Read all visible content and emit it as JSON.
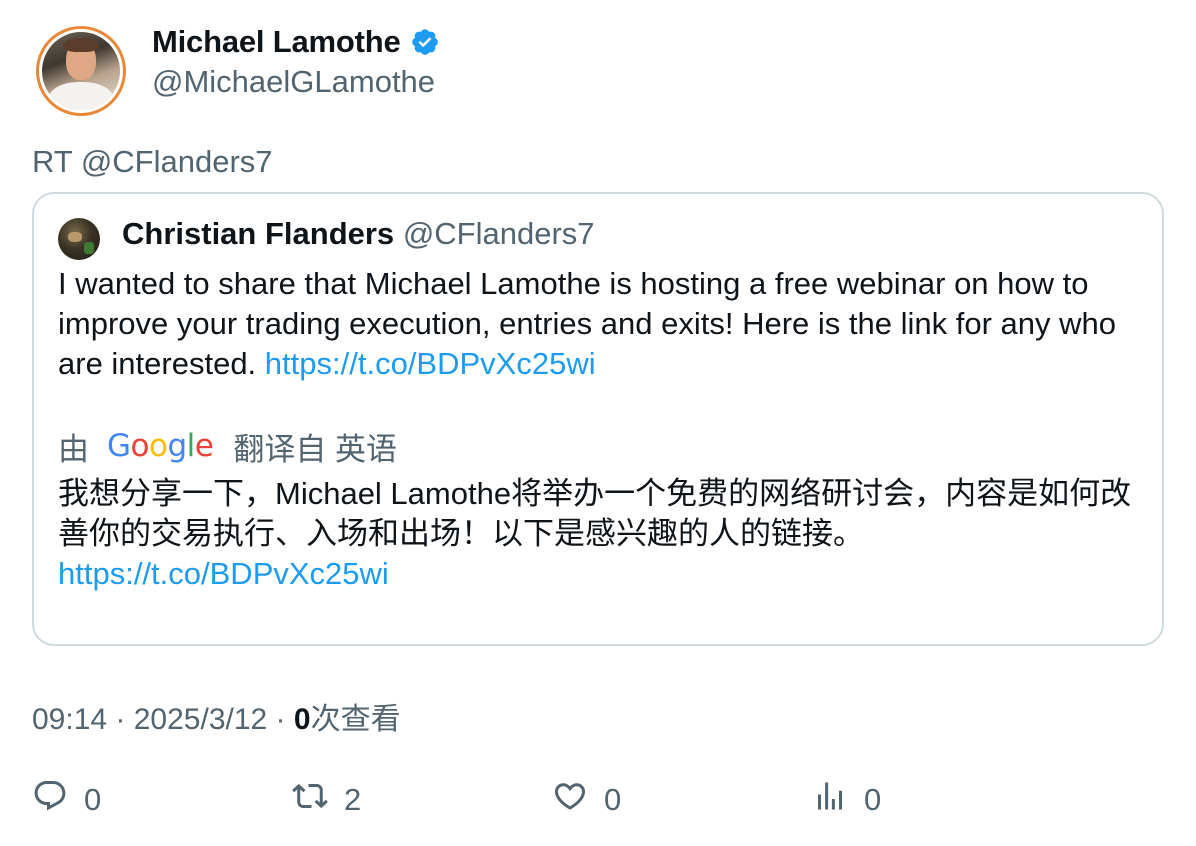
{
  "author": {
    "display_name": "Michael Lamothe",
    "handle": "@MichaelGLamothe",
    "avatar_icon": "user-avatar-photo",
    "verified_icon": "verified-badge-icon",
    "verified_color": "#1d9bf0"
  },
  "retweet_prefix": "RT @CFlanders7",
  "quoted": {
    "display_name": "Christian Flanders",
    "handle": "@CFlanders7",
    "text": "I wanted to share that Michael Lamothe is hosting a free webinar on how to improve your trading execution, entries and exits! Here is the link for any who are interested. ",
    "link": "https://t.co/BDPvXc25wi",
    "translation": {
      "by_label": "由",
      "google_logo": "Google",
      "translated_from": "翻译自 英语",
      "text": "我想分享一下，Michael Lamothe将举办一个免费的网络研讨会，内容是如何改善你的交易执行、入场和出场！以下是感兴趣的人的链接。",
      "link": "https://t.co/BDPvXc25wi"
    }
  },
  "meta": {
    "time": "09:14",
    "separator": " · ",
    "date": "2025/3/12",
    "views_count": "0",
    "views_label": "次查看"
  },
  "actions": {
    "reply_count": "0",
    "retweet_count": "2",
    "like_count": "0",
    "views_count": "0"
  },
  "colors": {
    "text_primary": "#0f1419",
    "text_secondary": "#536471",
    "link": "#1d9bf0",
    "card_border": "#cfd9de"
  }
}
